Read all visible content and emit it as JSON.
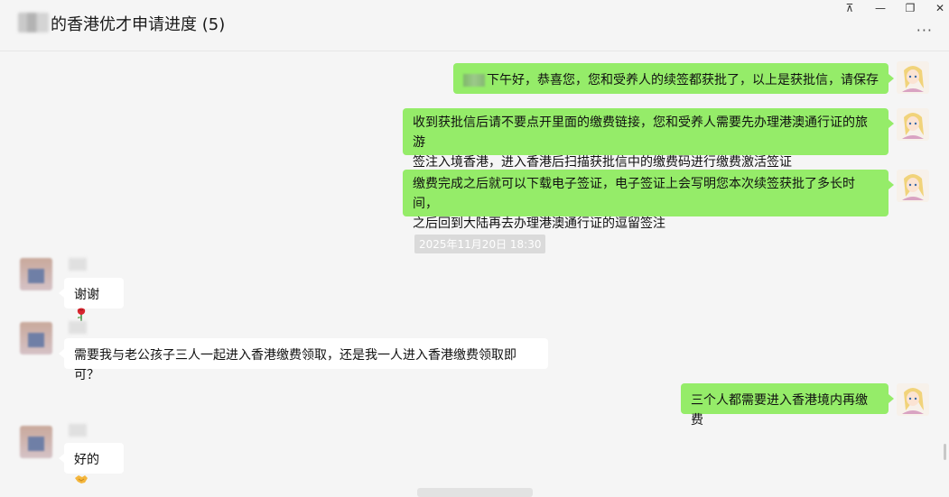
{
  "window": {
    "title": "的香港优才申请进度 (5)",
    "controls": {
      "pin": "⊼",
      "minimize": "—",
      "restore": "❐",
      "close": "✕"
    },
    "more": "···"
  },
  "messages": [
    {
      "side": "me",
      "text": "下午好，恭喜您，您和受养人的续签都获批了，以上是获批信，请保存"
    },
    {
      "side": "me",
      "line1": "收到获批信后请不要点开里面的缴费链接，您和受养人需要先办理港澳通行证的旅游",
      "line2": "签注入境香港，进入香港后扫描获批信中的缴费码进行缴费激活签证"
    },
    {
      "side": "me",
      "line1": "缴费完成之后就可以下载电子签证，电子签证上会写明您本次续签获批了多长时间，",
      "line2": "之后回到大陆再去办理港澳通行证的逗留签注"
    },
    {
      "side": "them",
      "text": "谢谢",
      "emoji": "rose"
    },
    {
      "side": "them",
      "text": "需要我与老公孩子三人一起进入香港缴费领取，还是我一人进入香港缴费领取即可？"
    },
    {
      "side": "me",
      "text": "三个人都需要进入香港境内再缴费"
    },
    {
      "side": "them",
      "text": "好的",
      "emoji": "handshake"
    }
  ],
  "timestamp": "2025年11月20日 18:30",
  "colors": {
    "my_bubble": "#95ec69",
    "their_bubble": "#ffffff",
    "background": "#f5f5f5"
  }
}
